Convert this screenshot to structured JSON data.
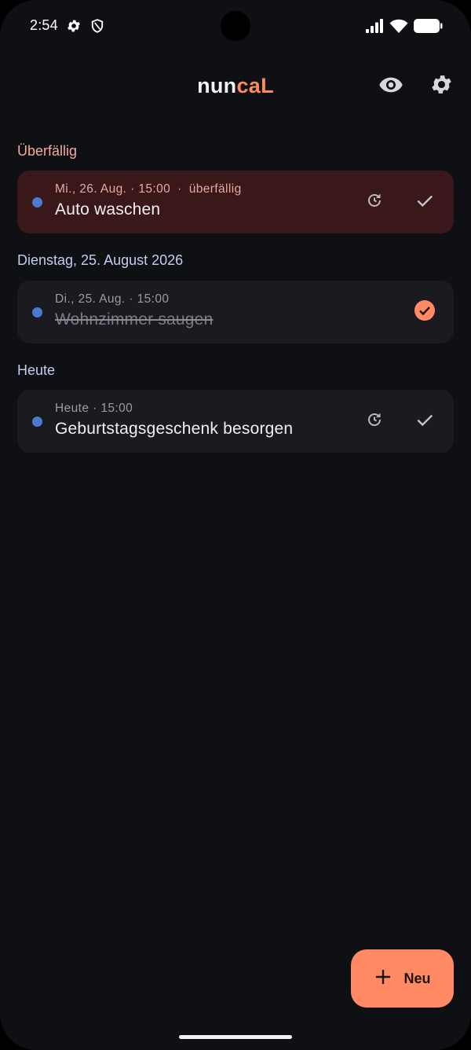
{
  "status_bar": {
    "time": "2:54",
    "icons": [
      "settings-gear-icon",
      "shield-icon",
      "signal-icon",
      "wifi-icon",
      "battery-icon"
    ]
  },
  "header": {
    "title_part1": "nun",
    "title_part2": "caL",
    "title_colors": {
      "part1": "#f3f3f5",
      "part2": "#ff8a5c"
    },
    "actions": [
      "eye-icon",
      "settings-icon"
    ]
  },
  "sections": [
    {
      "heading": "Überfällig",
      "heading_color": "#f5a99a",
      "tasks": [
        {
          "meta": "Mi., 26. Aug. · 15:00",
          "overdue_label": "überfällig",
          "title": "Auto waschen",
          "done": false,
          "style": "overdue"
        }
      ]
    },
    {
      "heading": "Dienstag, 25. August 2026",
      "heading_color": "#c3cdf2",
      "tasks": [
        {
          "meta": "Di., 25. Aug. · 15:00",
          "title": "Wohnzimmer saugen",
          "done": true,
          "style": "normal"
        }
      ]
    },
    {
      "heading": "Heute",
      "heading_color": "#c3cdf2",
      "tasks": [
        {
          "meta": "Heute · 15:00",
          "title": "Geburtstagsgeschenk besorgen",
          "done": false,
          "style": "normal"
        }
      ]
    }
  ],
  "fab": {
    "label": "Neu",
    "icon": "plus-icon",
    "color": "#ff8a63"
  },
  "colors": {
    "background": "#0f1014",
    "card": "#1a1b21",
    "overdue_card": "#3a1719",
    "dot": "#4a7bd0",
    "accent": "#ff8a5c"
  }
}
